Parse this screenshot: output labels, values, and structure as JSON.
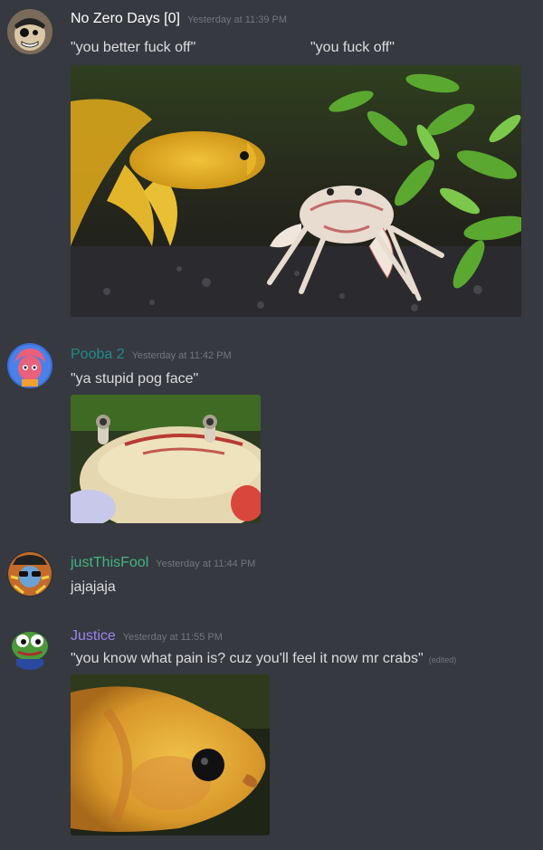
{
  "colors": {
    "background": "#36393f",
    "text": "#dcddde",
    "timestamp": "#72767d",
    "user_no_zero_days": "#ffffff",
    "user_pooba": "#1f8b8b",
    "user_justthisfool": "#43b581",
    "user_justice": "#9b84ec"
  },
  "messages": [
    {
      "username": "No Zero Days [0]",
      "timestamp": "Yesterday at 11:39 PM",
      "text_left": "\"you better fuck off\"",
      "text_right": "\"you fuck off\"",
      "avatar_icon": "pirate-skull-avatar",
      "attachment": "image of yellow betta fish facing a white crab among aquarium plants"
    },
    {
      "username": "Pooba 2",
      "timestamp": "Yesterday at 11:42 PM",
      "text": "\"ya stupid pog face\"",
      "avatar_icon": "pink-haired-character-avatar",
      "attachment": "close-up image of crab face"
    },
    {
      "username": "justThisFool",
      "timestamp": "Yesterday at 11:44 PM",
      "text": "jajajaja",
      "avatar_icon": "sunglasses-character-avatar"
    },
    {
      "username": "Justice",
      "timestamp": "Yesterday at 11:55 PM",
      "text": "\"you know what pain is? cuz you'll feel it now mr crabs\"",
      "edited": "(edited)",
      "avatar_icon": "pepe-frog-avatar",
      "attachment": "close-up image of yellow fish face"
    }
  ]
}
